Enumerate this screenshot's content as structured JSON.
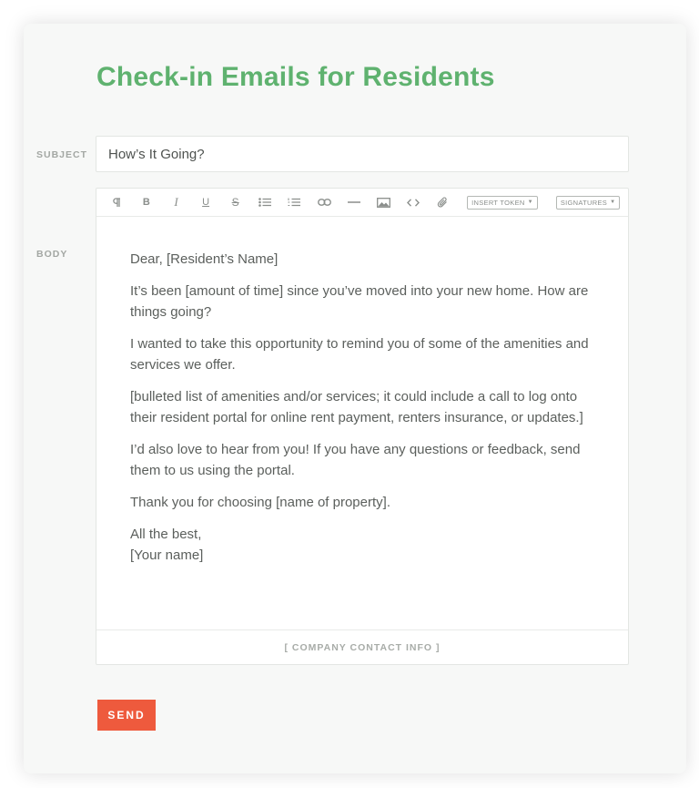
{
  "page": {
    "title": "Check-in Emails for Residents",
    "accent_color": "#5fb26f",
    "send_color": "#ee5a3d"
  },
  "subject": {
    "label": "SUBJECT",
    "value": "How’s It Going?"
  },
  "body": {
    "label": "BODY"
  },
  "toolbar": {
    "buttons": [
      "paragraph-icon",
      "bold-icon",
      "italic-icon",
      "underline-icon",
      "strikethrough-icon",
      "bullet-list-icon",
      "numbered-list-icon",
      "link-icon",
      "horizontal-rule-icon",
      "image-icon",
      "code-icon",
      "attachment-icon"
    ],
    "insert_token_label": "INSERT TOKEN",
    "signatures_label": "SIGNATURES"
  },
  "email": {
    "greeting": "Dear, [Resident’s Name]",
    "p1": "It’s been [amount of time] since you’ve moved into your new home. How are things going?",
    "p2": "I wanted to take this opportunity to remind you of some of the amenities and services we offer.",
    "p3": "[bulleted list of amenities and/or services; it could include a call to log onto their resident portal for online rent payment, renters insurance, or updates.]",
    "p4": "I’d also love to hear from you! If  you have any questions or feedback, send them to us using the portal.",
    "p5": "Thank you for choosing [name of property].",
    "closing": "All the best,",
    "signature": "[Your name]"
  },
  "footer": "[ COMPANY CONTACT INFO ]",
  "send_label": "SEND"
}
